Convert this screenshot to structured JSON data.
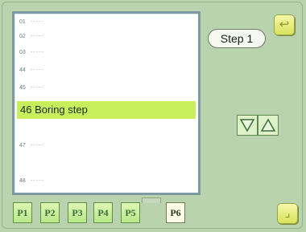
{
  "list": {
    "rows_top": [
      {
        "num": "01",
        "text": "-----"
      },
      {
        "num": "02",
        "text": "-----"
      },
      {
        "num": "03",
        "text": "-----"
      },
      {
        "num": "44",
        "text": "-----"
      },
      {
        "num": "45",
        "text": "-----"
      }
    ],
    "selected": "46 Boring step",
    "rows_bottom": [
      {
        "num": "47",
        "text": "-----"
      },
      {
        "num": "48",
        "text": "-----"
      }
    ]
  },
  "step_label": "Step 1",
  "tabs": [
    "P1",
    "P2",
    "P3",
    "P4",
    "P5",
    "P6"
  ],
  "active_tab": "P6",
  "colors": {
    "background": "#b9d3ae",
    "selected_row": "#c7ee5b",
    "accent_button": "#d8e25b",
    "tab": "#b9e88a"
  },
  "icons": {
    "top_right": "return-arrow-icon",
    "bottom_right": "confirm-corner-icon",
    "down": "triangle-down-icon",
    "up": "triangle-up-icon"
  }
}
